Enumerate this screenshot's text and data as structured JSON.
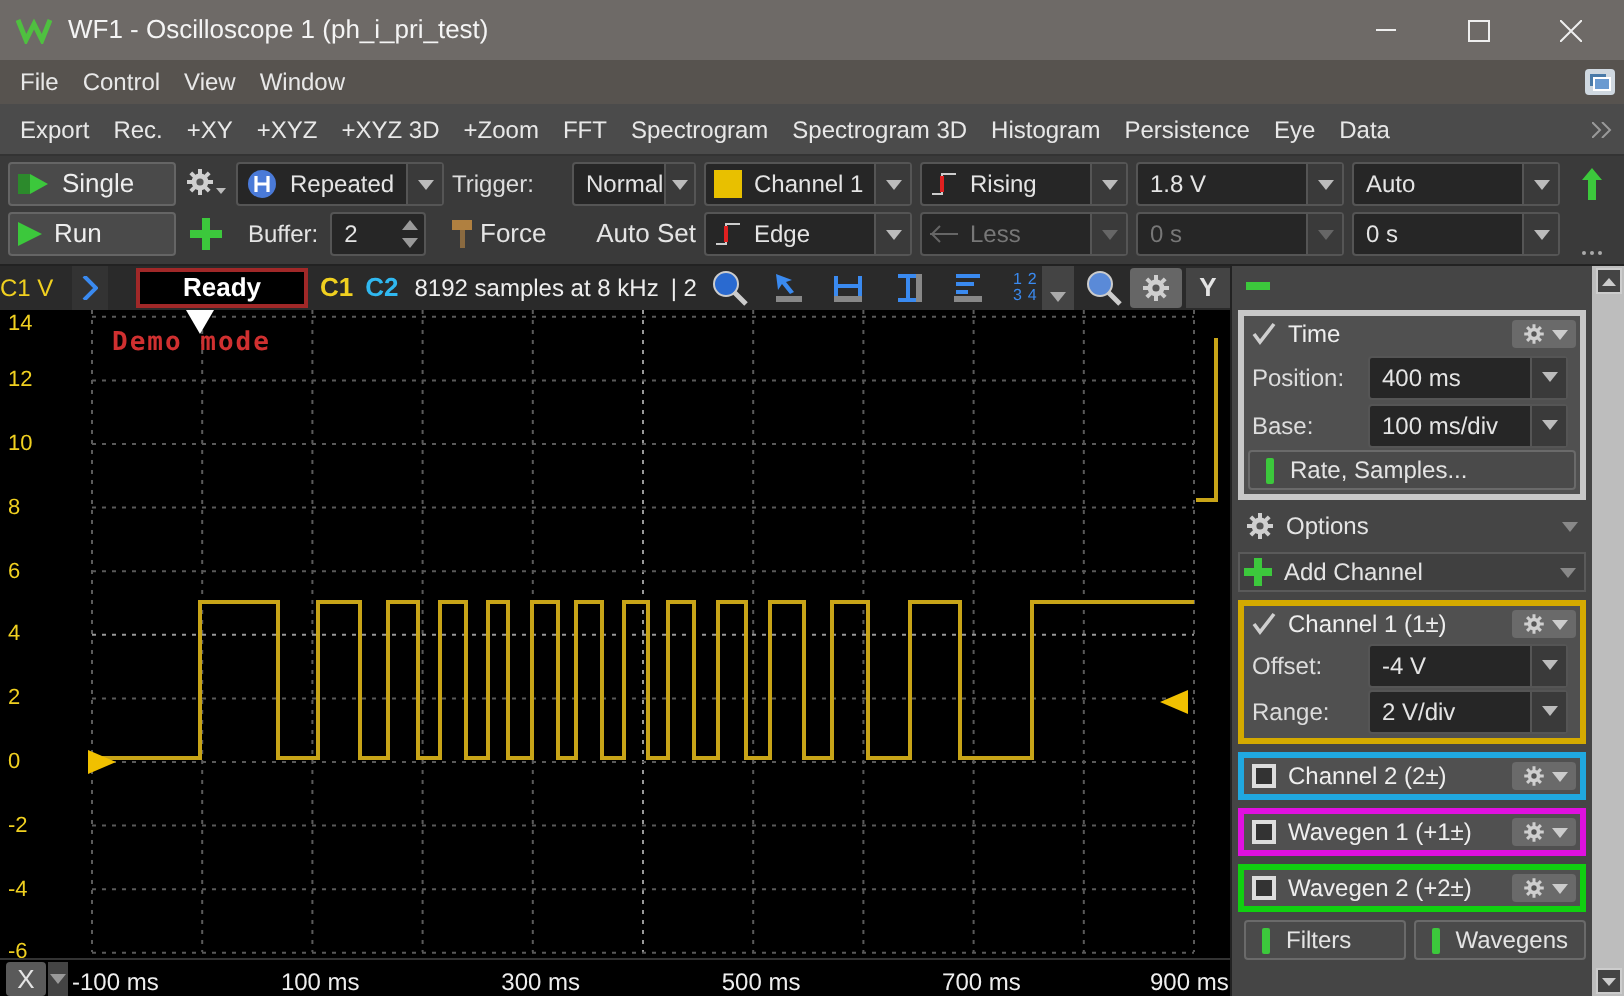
{
  "window": {
    "title": "WF1 - Oscilloscope 1 (ph_i_pri_test)"
  },
  "menu": [
    "File",
    "Control",
    "View",
    "Window"
  ],
  "toolbar": [
    "Export",
    "Rec.",
    "+XY",
    "+XYZ",
    "+XYZ 3D",
    "+Zoom",
    "FFT",
    "Spectrogram",
    "Spectrogram 3D",
    "Histogram",
    "Persistence",
    "Eye",
    "Data"
  ],
  "acquisition": {
    "single": "Single",
    "run": "Run",
    "mode": "Repeated",
    "buffer_label": "Buffer:",
    "buffer": "2"
  },
  "trigger": {
    "label": "Trigger:",
    "mode": "Normal",
    "force": "Force",
    "auto_set": "Auto Set",
    "source": "Channel 1",
    "type": "Edge",
    "condition": "Rising",
    "filter": {
      "value": "Less",
      "disabled": true
    },
    "level": "1.8 V",
    "hysteresis": {
      "value": "0 s",
      "disabled": true
    },
    "auto": "Auto",
    "holdoff": "0 s"
  },
  "plot": {
    "y_unit": "C1 V",
    "status": "Ready",
    "channels": [
      {
        "label": "C1",
        "color": "#f0d020"
      },
      {
        "label": "C2",
        "color": "#30b8f0"
      }
    ],
    "info": "8192 samples at 8 kHz",
    "count": "| 2",
    "cursor_numbers": [
      "1",
      "2",
      "3",
      "4"
    ],
    "y_button": "Y",
    "demo": "Demo mode",
    "y_ticks": [
      "14",
      "12",
      "10",
      "8",
      "6",
      "4",
      "2",
      "0",
      "-2",
      "-4",
      "-6"
    ],
    "x_ticks": [
      "-100 ms",
      "100 ms",
      "300 ms",
      "500 ms",
      "700 ms",
      "900 ms"
    ],
    "x_button": "X"
  },
  "panel": {
    "time": {
      "title": "Time",
      "checked": true,
      "fields": [
        {
          "label": "Position:",
          "value": "400 ms"
        },
        {
          "label": "Base:",
          "value": "100 ms/div"
        }
      ],
      "button": "Rate, Samples..."
    },
    "options": "Options",
    "add_channel": "Add Channel",
    "channels": [
      {
        "name": "Channel 1 (1±)",
        "checked": true,
        "color": "#d4aa00",
        "fields": [
          {
            "label": "Offset:",
            "value": "-4 V"
          },
          {
            "label": "Range:",
            "value": "2 V/div"
          }
        ]
      },
      {
        "name": "Channel 2 (2±)",
        "checked": false,
        "color": "#20a8e0"
      },
      {
        "name": "Wavegen 1 (+1±)",
        "checked": false,
        "color": "#e010e0"
      },
      {
        "name": "Wavegen 2 (+2±)",
        "checked": false,
        "color": "#10d010"
      }
    ],
    "buttons": [
      "Filters",
      "Wavegens"
    ]
  }
}
